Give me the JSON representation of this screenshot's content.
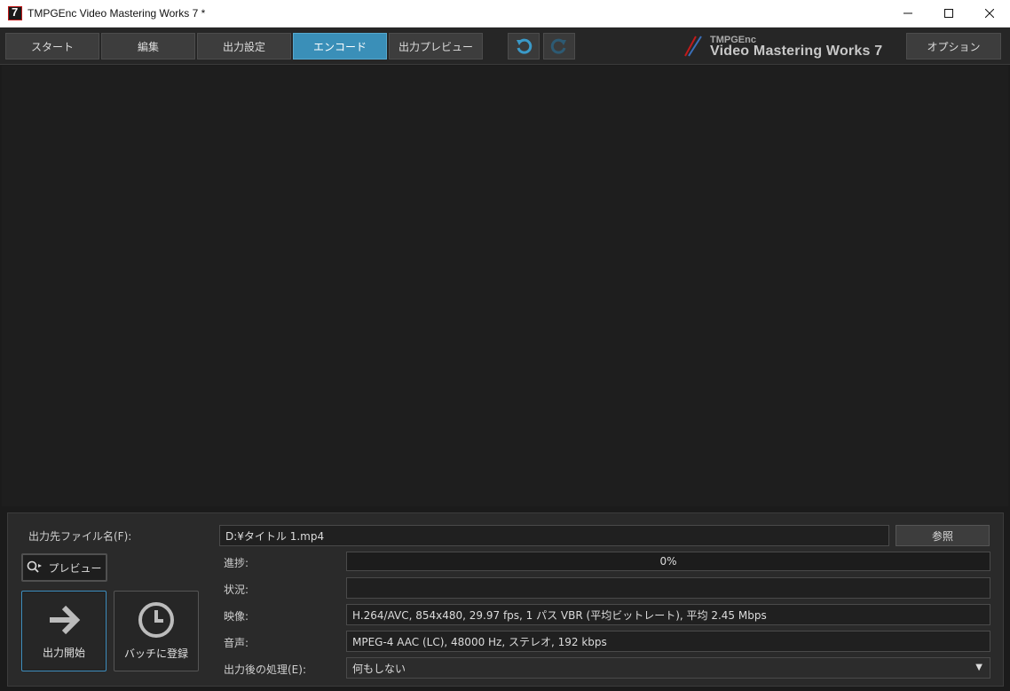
{
  "window": {
    "title": "TMPGEnc Video Mastering Works 7 *",
    "minimize_glyph": "—",
    "maximize_glyph": "☐",
    "close_glyph": "✕"
  },
  "toolbar": {
    "tabs": [
      {
        "label": "スタート",
        "active": false
      },
      {
        "label": "編集",
        "active": false
      },
      {
        "label": "出力設定",
        "active": false
      },
      {
        "label": "エンコード",
        "active": true
      },
      {
        "label": "出力プレビュー",
        "active": false
      }
    ],
    "undo_icon": "undo-icon",
    "redo_icon": "redo-icon",
    "logo_small": "TMPGEnc",
    "logo_big": "Video Mastering Works 7",
    "options_label": "オプション"
  },
  "panel": {
    "output_file_label": "出力先ファイル名(F):",
    "output_file_value": "D:¥タイトル 1.mp4",
    "browse_label": "参照",
    "preview_label": "プレビュー",
    "progress_label": "進捗:",
    "progress_text": "0%",
    "progress_value": 0,
    "status_label": "状況:",
    "status_value": "",
    "video_label": "映像:",
    "video_value": "H.264/AVC, 854x480, 29.97 fps, 1 パス VBR (平均ビットレート), 平均 2.45 Mbps",
    "audio_label": "音声:",
    "audio_value": "MPEG-4 AAC (LC), 48000 Hz, ステレオ, 192 kbps",
    "post_action_label": "出力後の処理(E):",
    "post_action_value": "何もしない",
    "start_label": "出力開始",
    "batch_label": "バッチに登録"
  },
  "colors": {
    "accent": "#3a8fb8",
    "background": "#1e1e1e"
  }
}
